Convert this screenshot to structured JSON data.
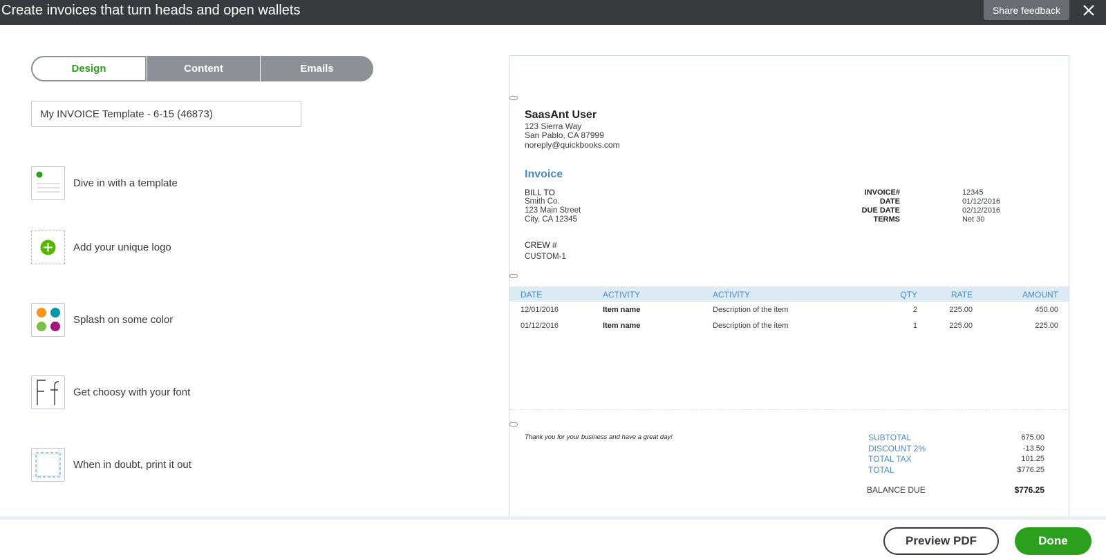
{
  "header": {
    "title": "Create invoices that turn heads and open wallets",
    "feedback_label": "Share feedback",
    "close_icon": "close-icon"
  },
  "tabs": [
    {
      "label": "Design",
      "active": true
    },
    {
      "label": "Content",
      "active": false
    },
    {
      "label": "Emails",
      "active": false
    }
  ],
  "template_name": {
    "value": "My INVOICE Template - 6-15 (46873)"
  },
  "features": [
    {
      "label": "Dive in with a template",
      "icon": "template-icon"
    },
    {
      "label": "Add your unique logo",
      "icon": "add-logo-icon"
    },
    {
      "label": "Splash on some color",
      "icon": "color-palette-icon"
    },
    {
      "label": "Get choosy with your font",
      "icon": "font-icon"
    },
    {
      "label": "When in doubt, print it out",
      "icon": "print-layout-icon"
    }
  ],
  "colors": {
    "brand_green": "#2ca01c",
    "accent_blue": "#4a8bbf",
    "header_dark": "#393a3d",
    "palette": [
      "#f7941d",
      "#0097a7",
      "#7ac143",
      "#a3177a"
    ]
  },
  "invoice": {
    "company": {
      "name": "SaasAnt User",
      "address1": "123 Sierra Way",
      "address2": "San Pablo, CA 87999",
      "email": "noreply@quickbooks.com"
    },
    "title": "Invoice",
    "bill_to": {
      "heading": "BILL TO",
      "name": "Smith Co.",
      "address1": "123 Main Street",
      "address2": "City, CA 12345"
    },
    "meta": [
      {
        "key": "INVOICE#",
        "value": "12345"
      },
      {
        "key": "DATE",
        "value": "01/12/2016"
      },
      {
        "key": "DUE DATE",
        "value": "02/12/2016"
      },
      {
        "key": "TERMS",
        "value": "Net 30"
      }
    ],
    "custom_field": {
      "label": "CREW #",
      "value": "CUSTOM-1"
    },
    "columns": [
      "DATE",
      "ACTIVITY",
      "ACTIVITY",
      "QTY",
      "RATE",
      "AMOUNT"
    ],
    "rows": [
      {
        "date": "12/01/2016",
        "item": "Item name",
        "description": "Description of the item",
        "qty": "2",
        "rate": "225.00",
        "amount": "450.00"
      },
      {
        "date": "01/12/2016",
        "item": "Item name",
        "description": "Description of the item",
        "qty": "1",
        "rate": "225.00",
        "amount": "225.00"
      }
    ],
    "message": "Thank you for your business and have a great day!",
    "totals": [
      {
        "label": "SUBTOTAL",
        "value": "675.00"
      },
      {
        "label": "DISCOUNT 2%",
        "value": "-13.50"
      },
      {
        "label": "TOTAL TAX",
        "value": "101.25"
      },
      {
        "label": "TOTAL",
        "value": "$776.25"
      }
    ],
    "balance": {
      "label": "BALANCE DUE",
      "value": "$776.25"
    }
  },
  "footer": {
    "preview_label": "Preview PDF",
    "done_label": "Done"
  }
}
